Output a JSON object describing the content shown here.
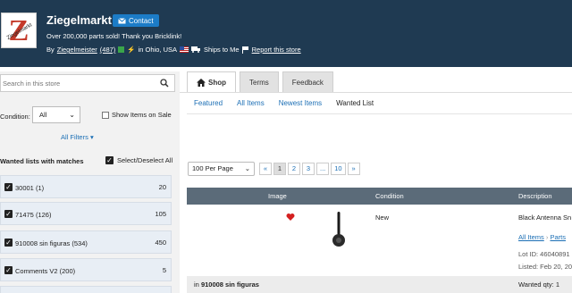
{
  "header": {
    "store_name": "Ziegelmarkt",
    "logo_text": "Ziegelmarkt",
    "contact_label": "Contact",
    "tagline": "Over 200,000 parts sold! Thank you Bricklink!",
    "by_label": "By",
    "seller": "Ziegelmeister",
    "feedback": "(487)",
    "location": "in Ohio, USA",
    "ships": "Ships to Me",
    "report": "Report this store"
  },
  "sidebar": {
    "search_placeholder": "Search in this store",
    "condition_label": "Condition:",
    "condition_value": "All",
    "show_sale_label": "Show Items on Sale",
    "all_filters": "All Filters",
    "wanted_title": "Wanted lists with matches",
    "select_all": "Select/Deselect All",
    "wanted_lists": [
      {
        "name": "30001",
        "matches": "(1)",
        "count": "20"
      },
      {
        "name": "71475",
        "matches": "(126)",
        "count": "105"
      },
      {
        "name": "910008 sin figuras",
        "matches": "(534)",
        "count": "450"
      },
      {
        "name": "Comments V2",
        "matches": "(200)",
        "count": "5"
      }
    ]
  },
  "tabs": [
    {
      "label": "Shop",
      "active": true
    },
    {
      "label": "Terms",
      "active": false
    },
    {
      "label": "Feedback",
      "active": false
    }
  ],
  "subnav": [
    "Featured",
    "All Items",
    "Newest Items",
    "Wanted List"
  ],
  "pagination": {
    "per_page": "100 Per Page",
    "pages": [
      "«",
      "1",
      "2",
      "3",
      "...",
      "10",
      "»"
    ]
  },
  "table": {
    "headers": [
      "Image",
      "Condition",
      "Description"
    ],
    "row": {
      "condition": "New",
      "description": "Black Antenna Sn",
      "crumb1": "All Items",
      "crumb2": "Parts",
      "lot": "Lot ID: 46040891",
      "listed": "Listed: Feb 20, 20"
    },
    "footer_in_prefix": "in",
    "footer_list": "910008 sin figuras",
    "wanted_qty": "Wanted qty: 1"
  }
}
